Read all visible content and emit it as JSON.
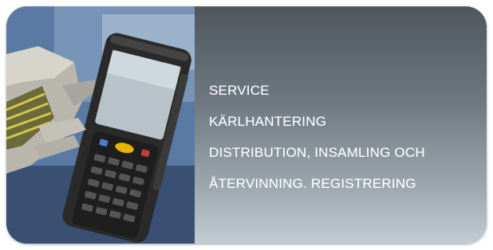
{
  "banner": {
    "image_subject": "handheld-barcode-scanner-photo",
    "colors": {
      "panel_top": "#4f575d",
      "panel_bottom": "#c3ccd2",
      "text": "#ffffff",
      "photo_background": "#4e6d97",
      "glove": "#b9b7ad",
      "device_body": "#2a2a2a",
      "device_screen": "#b8c3c9",
      "keypad_accent": "#e8b400"
    },
    "lines": [
      "SERVICE",
      "KÄRLHANTERING",
      "DISTRIBUTION, INSAMLING OCH",
      "ÅTERVINNING. REGISTRERING"
    ]
  }
}
